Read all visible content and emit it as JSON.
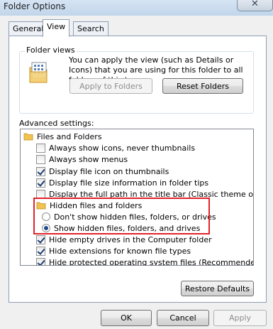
{
  "window": {
    "title": "Folder Options",
    "close_glyph": "✕"
  },
  "tabs": [
    {
      "label": "General",
      "active": false
    },
    {
      "label": "View",
      "active": true
    },
    {
      "label": "Search",
      "active": false
    }
  ],
  "folder_views": {
    "legend": "Folder views",
    "description": "You can apply the view (such as Details or Icons) that you are using for this folder to all folders of this type.",
    "apply_label": "Apply to Folders",
    "reset_label": "Reset Folders"
  },
  "advanced": {
    "label": "Advanced settings:",
    "items": [
      {
        "type": "folder",
        "label": "Files and Folders"
      },
      {
        "type": "checkbox",
        "label": "Always show icons, never thumbnails",
        "checked": false
      },
      {
        "type": "checkbox",
        "label": "Always show menus",
        "checked": false
      },
      {
        "type": "checkbox",
        "label": "Display file icon on thumbnails",
        "checked": true
      },
      {
        "type": "checkbox",
        "label": "Display file size information in folder tips",
        "checked": true
      },
      {
        "type": "checkbox",
        "label": "Display the full path in the title bar (Classic theme only)",
        "checked": false
      },
      {
        "type": "folder",
        "label": "Hidden files and folders"
      },
      {
        "type": "radio",
        "label": "Don't show hidden files, folders, or drives",
        "checked": false
      },
      {
        "type": "radio",
        "label": "Show hidden files, folders, and drives",
        "checked": true
      },
      {
        "type": "checkbox",
        "label": "Hide empty drives in the Computer folder",
        "checked": true
      },
      {
        "type": "checkbox",
        "label": "Hide extensions for known file types",
        "checked": true
      },
      {
        "type": "checkbox",
        "label": "Hide protected operating system files (Recommended)",
        "checked": true
      }
    ]
  },
  "buttons": {
    "restore": "Restore Defaults",
    "ok": "OK",
    "cancel": "Cancel",
    "apply": "Apply"
  },
  "colors": {
    "highlight": "#e0232a",
    "accent": "#1d4a8a"
  }
}
